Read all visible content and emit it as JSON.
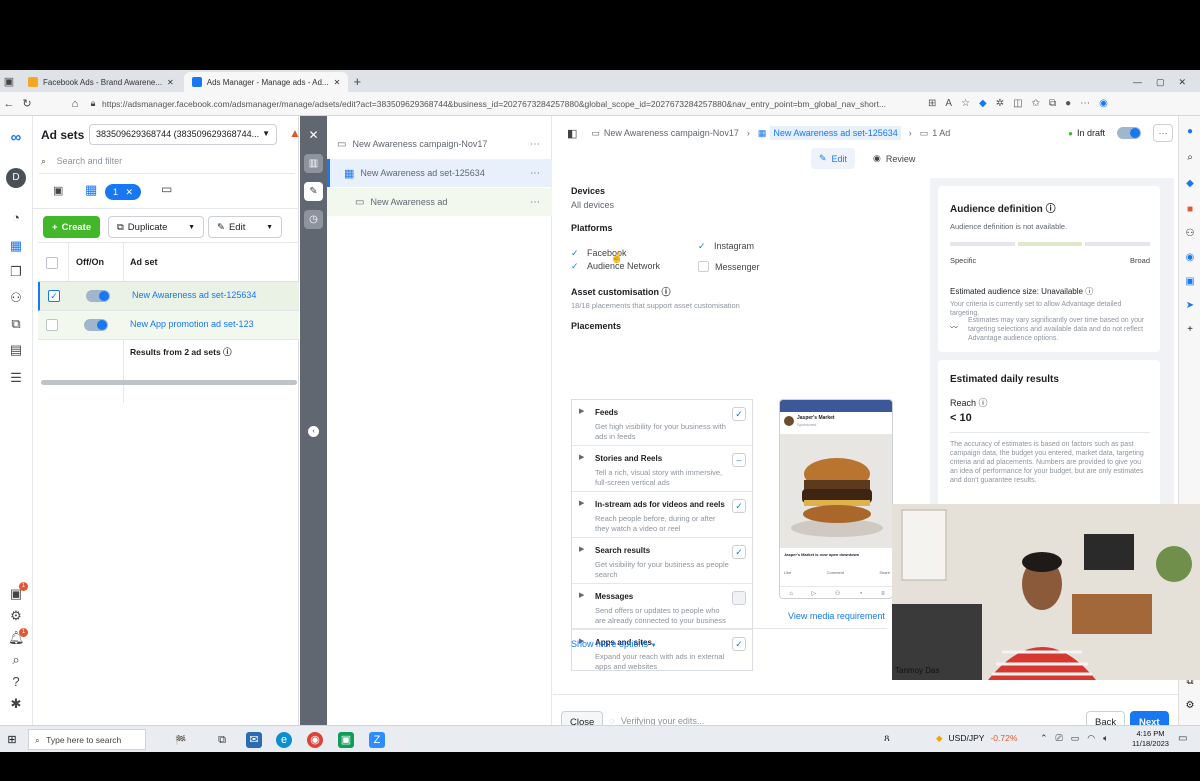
{
  "browser": {
    "tabs": [
      {
        "title": "Facebook Ads - Brand Awarene...",
        "active": false
      },
      {
        "title": "Ads Manager - Manage ads - Ad...",
        "active": true
      }
    ],
    "url": "https://adsmanager.facebook.com/adsmanager/manage/adsets/edit?act=383509629368744&business_id=2027673284257880&global_scope_id=2027673284257880&nav_entry_point=bm_global_nav_short..."
  },
  "nav": {
    "avatar_letter": "D",
    "badges": [
      "1",
      "1"
    ]
  },
  "adsets": {
    "title": "Ad sets",
    "account": "383509629368744 (383509629368744...",
    "search_placeholder": "Search and filter",
    "filter_chip": "1",
    "create_label": "Create",
    "duplicate_label": "Duplicate",
    "edit_label": "Edit",
    "columns": {
      "onoff": "Off/On",
      "adset": "Ad set"
    },
    "rows": [
      {
        "name": "New Awareness ad set-125634",
        "selected": true
      },
      {
        "name": "New App promotion ad set-123",
        "selected": false
      }
    ],
    "results": "Results from 2 ad sets"
  },
  "tree": {
    "campaign": "New Awareness campaign-Nov17",
    "adset": "New Awareness ad set-125634",
    "ad": "New Awareness ad"
  },
  "editor": {
    "crumb_campaign": "New Awareness campaign-Nov17",
    "crumb_adset": "New Awareness ad set-125634",
    "crumb_ad": "1 Ad",
    "status": "In draft",
    "edit_tab": "Edit",
    "review_tab": "Review",
    "devices_label": "Devices",
    "devices_value": "All devices",
    "platforms_label": "Platforms",
    "platforms": [
      {
        "name": "Facebook",
        "checked": true
      },
      {
        "name": "Instagram",
        "checked": true
      },
      {
        "name": "Audience Network",
        "checked": true
      },
      {
        "name": "Messenger",
        "checked": false
      }
    ],
    "asset_label": "Asset customisation",
    "asset_sub": "18/18 placements that support asset customisation",
    "placements_label": "Placements",
    "placements": [
      {
        "title": "Feeds",
        "desc": "Get high visibility for your business with ads in feeds",
        "state": "check"
      },
      {
        "title": "Stories and Reels",
        "desc": "Tell a rich, visual story with immersive, full-screen vertical ads",
        "state": "dash"
      },
      {
        "title": "In-stream ads for videos and reels",
        "desc": "Reach people before, during or after they watch a video or reel",
        "state": "check"
      },
      {
        "title": "Search results",
        "desc": "Get visibility for your business as people search",
        "state": "check"
      },
      {
        "title": "Messages",
        "desc": "Send offers or updates to people who are already connected to your business",
        "state": "empty"
      },
      {
        "title": "Apps and sites",
        "desc": "Expand your reach with ads in external apps and websites",
        "state": "check"
      }
    ],
    "preview_page": "Jasper's Market",
    "preview_sponsored": "Sponsored",
    "preview_cta": "Jasper's Market is now open downtown",
    "preview_actions": [
      "Like",
      "Comment",
      "Share"
    ],
    "view_media": "View media requirement",
    "show_more": "Show more options",
    "close_label": "Close",
    "verifying": "Verifying your edits...",
    "back_label": "Back",
    "next_label": "Next"
  },
  "audience": {
    "title": "Audience definition",
    "not_available": "Audience definition is not available.",
    "specific": "Specific",
    "broad": "Broad",
    "est_size": "Estimated audience size: Unavailable",
    "criteria": "Your criteria is currently set to allow Advantage detailed targeting.",
    "estimates_note": "Estimates may vary significantly over time based on your targeting selections and available data and do not reflect Advantage audience options."
  },
  "daily": {
    "title": "Estimated daily results",
    "reach_label": "Reach",
    "reach_value": "< 10",
    "note": "The accuracy of estimates is based on factors such as past campaign data, the budget you entered, market data, targeting criteria and ad placements. Numbers are provided to give you an idea of performance for your budget, but are only estimates and don't guarantee results."
  },
  "webcam": {
    "name": "Tanmoy Das"
  },
  "taskbar": {
    "search_placeholder": "Type here to search",
    "ticker": "USD/JPY",
    "ticker_change": "-0.72%",
    "time": "4:16 PM",
    "date": "11/18/2023"
  },
  "colors": {
    "primary": "#1877f2",
    "create": "#42b72a",
    "negative": "#e4572e"
  }
}
